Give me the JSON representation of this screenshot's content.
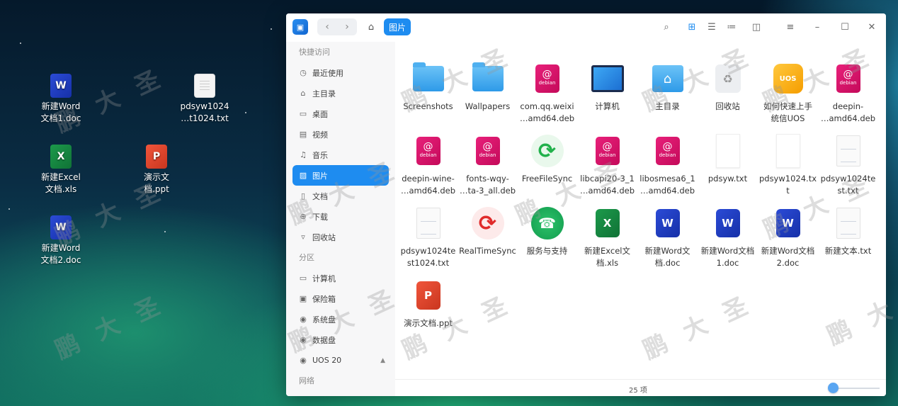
{
  "desktop": {
    "icons": [
      {
        "label": "新建Word\n文档1.doc",
        "badge": "W"
      },
      {
        "label": "pdsyw1024\n…t1024.txt",
        "badge": ""
      },
      {
        "label": "新建Excel\n文档.xls",
        "badge": "X"
      },
      {
        "label": "演示文\n档.ppt",
        "badge": "P"
      },
      {
        "label": "新建Word\n文档2.doc",
        "badge": "W"
      }
    ]
  },
  "window": {
    "breadcrumb": "图片",
    "nav": {
      "back": "‹",
      "forward": "›",
      "home": "⌂"
    },
    "toolbar_icons": [
      "search-icon",
      "icon-view-icon",
      "list-view-icon",
      "tree-view-icon",
      "details-panel-icon",
      "menu-icon",
      "minimize-icon",
      "maximize-icon",
      "close-icon"
    ]
  },
  "sidebar": {
    "quick_access_header": "快捷访问",
    "items": [
      {
        "label": "最近使用",
        "icon": "clock-icon"
      },
      {
        "label": "主目录",
        "icon": "home-icon"
      },
      {
        "label": "桌面",
        "icon": "desktop-icon"
      },
      {
        "label": "视频",
        "icon": "video-icon"
      },
      {
        "label": "音乐",
        "icon": "music-icon"
      },
      {
        "label": "图片",
        "icon": "picture-icon"
      },
      {
        "label": "文档",
        "icon": "document-icon"
      },
      {
        "label": "下载",
        "icon": "download-icon"
      },
      {
        "label": "回收站",
        "icon": "trash-icon"
      }
    ],
    "partition_header": "分区",
    "partitions": [
      {
        "label": "计算机",
        "icon": "computer-icon"
      },
      {
        "label": "保险箱",
        "icon": "safe-icon"
      },
      {
        "label": "系统盘",
        "icon": "disk-icon"
      },
      {
        "label": "数据盘",
        "icon": "disk-icon"
      },
      {
        "label": "UOS 20",
        "icon": "disk-icon"
      }
    ],
    "network_header": "网络"
  },
  "files": [
    {
      "name": "Screenshots",
      "type": "folder"
    },
    {
      "name": "Wallpapers",
      "type": "folder"
    },
    {
      "name": "com.qq.weixi\n…amd64.deb",
      "type": "deb"
    },
    {
      "name": "计算机",
      "type": "computer"
    },
    {
      "name": "主目录",
      "type": "home"
    },
    {
      "name": "回收站",
      "type": "trash"
    },
    {
      "name": "如何快速上手\n统信UOS",
      "type": "uos"
    },
    {
      "name": "deepin-\n…amd64.deb",
      "type": "deb"
    },
    {
      "name": "deepin-wine-\n…amd64.deb",
      "type": "deb"
    },
    {
      "name": "fonts-wqy-\n…ta-3_all.deb",
      "type": "deb"
    },
    {
      "name": "FreeFileSync",
      "type": "ffs"
    },
    {
      "name": "libcapi20-3_1\n…amd64.deb",
      "type": "deb"
    },
    {
      "name": "libosmesa6_1\n…amd64.deb",
      "type": "deb"
    },
    {
      "name": "pdsyw.txt",
      "type": "blank"
    },
    {
      "name": "pdsyw1024.tx\nt",
      "type": "blank"
    },
    {
      "name": "pdsyw1024te\nst.txt",
      "type": "text"
    },
    {
      "name": "pdsyw1024te\nst1024.txt",
      "type": "text"
    },
    {
      "name": "RealTimeSync",
      "type": "rts"
    },
    {
      "name": "服务与支持",
      "type": "support"
    },
    {
      "name": "新建Excel文\n档.xls",
      "type": "excel"
    },
    {
      "name": "新建Word文\n档.doc",
      "type": "word"
    },
    {
      "name": "新建Word文档\n1.doc",
      "type": "word"
    },
    {
      "name": "新建Word文档\n2.doc",
      "type": "word"
    },
    {
      "name": "新建文本.txt",
      "type": "text"
    },
    {
      "name": "演示文档.ppt",
      "type": "ppt"
    }
  ],
  "status": {
    "count_text": "25 项",
    "zoom_level": 0.1
  },
  "watermark": "鹏大圣"
}
